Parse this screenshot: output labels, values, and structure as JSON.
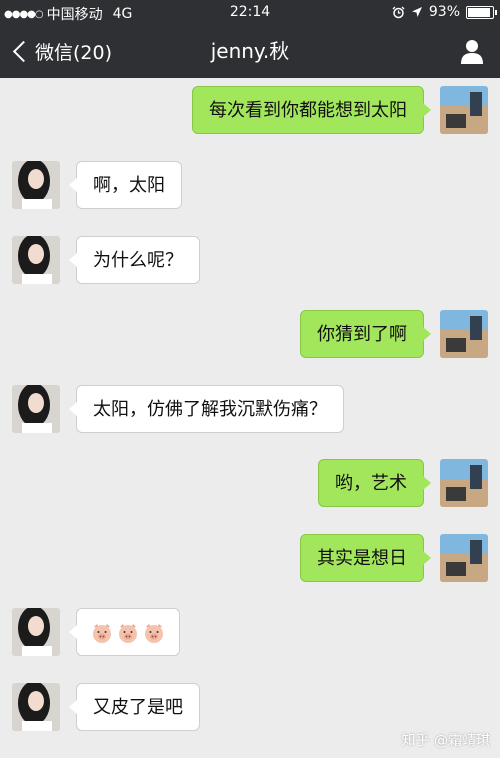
{
  "status_bar": {
    "carrier": "中国移动",
    "network": "4G",
    "time": "22:14",
    "battery": "93%",
    "battery_level": 0.93,
    "signal_dots": "●●●●○"
  },
  "nav": {
    "back_label": "微信(20)",
    "title": "jenny.秋"
  },
  "messages": [
    {
      "side": "right",
      "text": "每次看到你都能想到太阳"
    },
    {
      "side": "left",
      "text": "啊，太阳"
    },
    {
      "side": "left",
      "text": "为什么呢？"
    },
    {
      "side": "right",
      "text": "你猜到了啊"
    },
    {
      "side": "left",
      "text": "太阳，仿佛了解我沉默伤痛？"
    },
    {
      "side": "right",
      "text": "哟，艺术"
    },
    {
      "side": "right",
      "text": "其实是想日"
    },
    {
      "side": "left",
      "emoji": [
        "pig-face-icon",
        "pig-face-icon",
        "pig-face-icon"
      ]
    },
    {
      "side": "left",
      "text": "又皮了是吧"
    }
  ],
  "watermark": "知乎 @霜靖琪",
  "colors": {
    "nav_bg": "#2e3033",
    "chat_bg": "#ececec",
    "sent_bubble": "#a2e65b",
    "received_bubble": "#ffffff"
  }
}
